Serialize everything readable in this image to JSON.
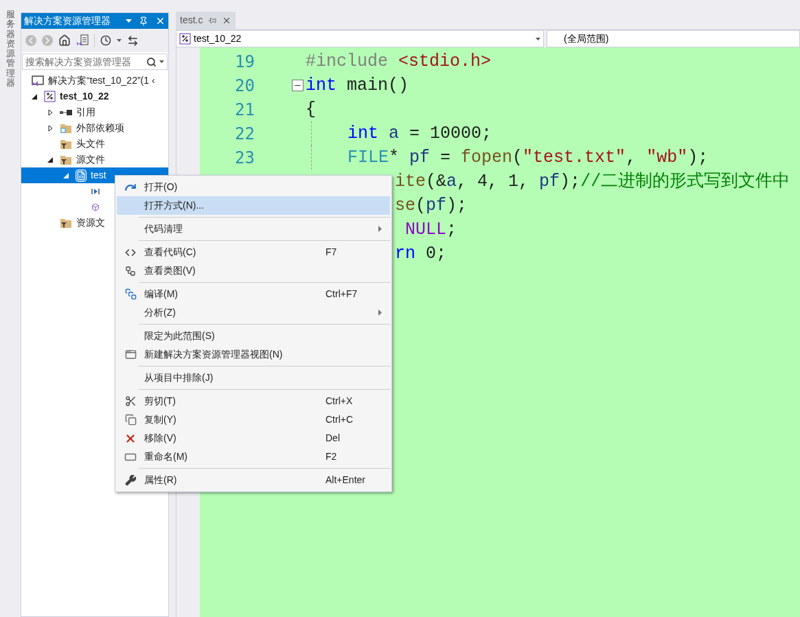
{
  "side_strip": {
    "label": "服务器资源管理器"
  },
  "solution_explorer": {
    "title": "解决方案资源管理器",
    "search": {
      "placeholder": "搜索解决方案资源管理器"
    },
    "tree": [
      {
        "label": "解决方案“test_10_22”(1 ‹",
        "kind": "solution",
        "selected": false,
        "children": [
          {
            "label": "test_10_22",
            "kind": "project",
            "expanded": true,
            "selected": false,
            "children": [
              {
                "label": "引用",
                "kind": "references",
                "expanded": false,
                "selected": false
              },
              {
                "label": "外部依赖项",
                "kind": "external",
                "expanded": false,
                "selected": false
              },
              {
                "label": "头文件",
                "kind": "filter",
                "selected": false
              },
              {
                "label": "源文件",
                "kind": "filter",
                "expanded": true,
                "selected": false,
                "children": [
                  {
                    "label": "test",
                    "kind": "file",
                    "expanded": true,
                    "selected": true,
                    "children": [
                      {
                        "kind": "function",
                        "selected": false
                      },
                      {
                        "kind": "global",
                        "selected": false
                      }
                    ]
                  }
                ]
              },
              {
                "label": "资源文",
                "kind": "filter",
                "selected": false
              }
            ]
          }
        ]
      }
    ]
  },
  "editor": {
    "tab": {
      "label": "test.c"
    },
    "project_dropdown": {
      "value": "test_10_22"
    },
    "scope_dropdown": {
      "value": "(全局范围)"
    },
    "lines": [
      {
        "number": "19",
        "tokens": [
          {
            "kind": "preproc",
            "t": "#include "
          },
          {
            "kind": "string",
            "t": "<stdio.h>"
          }
        ]
      },
      {
        "number": "20",
        "foldable": true,
        "tokens": [
          {
            "kind": "keyword",
            "t": "int"
          },
          {
            "kind": "plain",
            "t": " main()"
          }
        ]
      },
      {
        "number": "21",
        "tokens": [
          {
            "kind": "plain",
            "t": "{"
          }
        ]
      },
      {
        "number": "22",
        "indented": true,
        "tokens": [
          {
            "kind": "keyword",
            "t": "int"
          },
          {
            "kind": "var",
            "t": " a"
          },
          {
            "kind": "plain",
            "t": " = 10000;"
          }
        ]
      },
      {
        "number": "23",
        "indented": true,
        "tokens": [
          {
            "kind": "type",
            "t": "FILE"
          },
          {
            "kind": "plain",
            "t": "* "
          },
          {
            "kind": "var",
            "t": "pf"
          },
          {
            "kind": "plain",
            "t": " = "
          },
          {
            "kind": "func",
            "t": "fopen"
          },
          {
            "kind": "plain",
            "t": "("
          },
          {
            "kind": "string",
            "t": "\"test.txt\""
          },
          {
            "kind": "plain",
            "t": ", "
          },
          {
            "kind": "string",
            "t": "\"wb\""
          },
          {
            "kind": "plain",
            "t": ");"
          }
        ]
      },
      {
        "partial": true,
        "tokens": [
          {
            "kind": "func",
            "t": "ite"
          },
          {
            "kind": "plain",
            "t": "(&"
          },
          {
            "kind": "var",
            "t": "a"
          },
          {
            "kind": "plain",
            "t": ", 4, 1, "
          },
          {
            "kind": "var",
            "t": "pf"
          },
          {
            "kind": "plain",
            "t": ");"
          },
          {
            "kind": "comment",
            "t": "//二进制的形式写到文件中"
          }
        ]
      },
      {
        "partial": true,
        "tokens": [
          {
            "kind": "func",
            "t": "se"
          },
          {
            "kind": "plain",
            "t": "("
          },
          {
            "kind": "var",
            "t": "pf"
          },
          {
            "kind": "plain",
            "t": ");"
          }
        ]
      },
      {
        "partial": true,
        "tokens": [
          {
            "kind": "macro",
            "t": " NULL"
          },
          {
            "kind": "plain",
            "t": ";"
          }
        ]
      },
      {
        "partial": true,
        "tokens": [
          {
            "kind": "keyword",
            "t": "rn"
          },
          {
            "kind": "plain",
            "t": " 0;"
          }
        ]
      }
    ]
  },
  "context_menu": {
    "groups": [
      [
        {
          "label": "打开(O)",
          "kind": "open",
          "selected": false
        },
        {
          "label": "打开方式(N)...",
          "selected": true
        }
      ],
      [
        {
          "label": "代码清理",
          "submenu": true,
          "selected": false
        }
      ],
      [
        {
          "label": "查看代码(C)",
          "kind": "code",
          "shortcut": "F7",
          "selected": false
        },
        {
          "label": "查看类图(V)",
          "kind": "diagram",
          "selected": false
        }
      ],
      [
        {
          "label": "编译(M)",
          "kind": "build",
          "shortcut": "Ctrl+F7",
          "selected": false
        },
        {
          "label": "分析(Z)",
          "submenu": true,
          "selected": false
        }
      ],
      [
        {
          "label": "限定为此范围(S)",
          "selected": false
        },
        {
          "label": "新建解决方案资源管理器视图(N)",
          "kind": "newview",
          "selected": false
        }
      ],
      [
        {
          "label": "从项目中排除(J)",
          "selected": false
        }
      ],
      [
        {
          "label": "剪切(T)",
          "kind": "cut",
          "shortcut": "Ctrl+X",
          "selected": false
        },
        {
          "label": "复制(Y)",
          "kind": "copy",
          "shortcut": "Ctrl+C",
          "selected": false
        },
        {
          "label": "移除(V)",
          "kind": "remove",
          "shortcut": "Del",
          "selected": false
        },
        {
          "label": "重命名(M)",
          "kind": "rename",
          "shortcut": "F2",
          "selected": false
        }
      ],
      [
        {
          "label": "属性(R)",
          "kind": "wrench",
          "shortcut": "Alt+Enter",
          "selected": false
        }
      ]
    ]
  }
}
